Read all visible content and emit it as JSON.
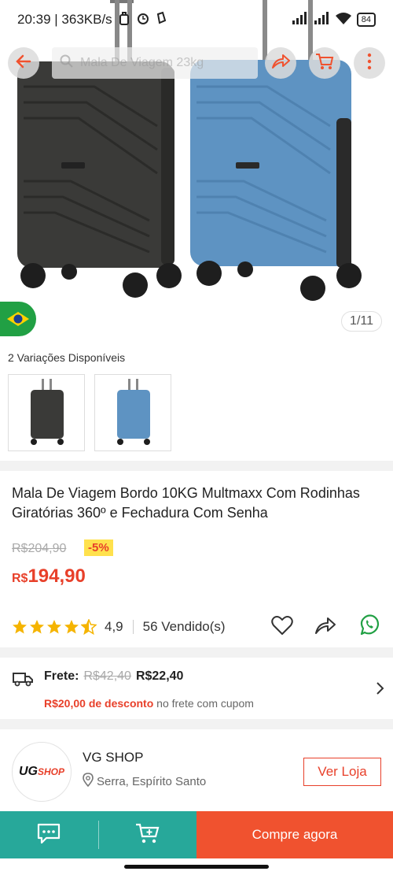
{
  "status_bar": {
    "time_speed": "20:39 | 363KB/s",
    "battery": "84"
  },
  "search": {
    "placeholder": "Mala De Viagem 23kg"
  },
  "image_counter": "1/11",
  "variations": {
    "label": "2 Variações Disponíveis",
    "count": 2
  },
  "product": {
    "title": "Mala De Viagem Bordo 10KG Multmaxx Com Rodinhas Giratórias 360º e Fechadura Com Senha",
    "old_price": "R$204,90",
    "discount": "-5%",
    "price_currency": "R$",
    "price_value": "194,90",
    "rating": "4,9",
    "rating_stars": 4.5,
    "sold": "56 Vendido(s)"
  },
  "shipping": {
    "label": "Frete:",
    "old_price": "R$42,40",
    "new_price": "R$22,40",
    "discount_text": "R$20,00 de desconto",
    "discount_suffix": "no frete com cupom"
  },
  "store": {
    "logo_text_main": "UG",
    "logo_text_sub": "SHOP",
    "name": "VG SHOP",
    "location": "Serra, Espírito Santo",
    "button": "Ver Loja"
  },
  "bottom": {
    "buy_label": "Compre agora"
  },
  "colors": {
    "accent": "#f0522f",
    "price_red": "#e8402a",
    "teal": "#27a89a",
    "discount_bg": "#ffe14d",
    "whatsapp": "#21a044"
  }
}
